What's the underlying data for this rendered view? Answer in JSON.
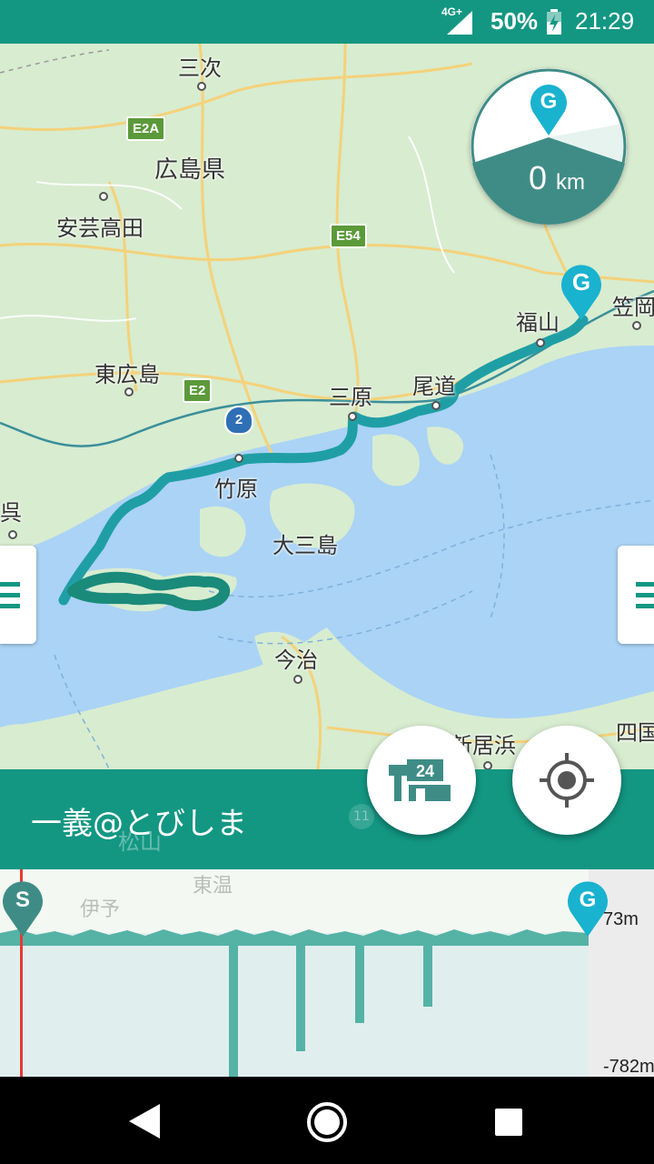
{
  "status_bar": {
    "network": "4G+",
    "battery": "50%",
    "time": "21:29"
  },
  "map": {
    "places": [
      "三次",
      "広島県",
      "安芸高田",
      "東広島",
      "三原",
      "尾道",
      "福山",
      "笠岡",
      "竹原",
      "呉",
      "大三島",
      "今治",
      "新居浜",
      "四国",
      "松山",
      "東温",
      "伊予"
    ],
    "road_shields": [
      "E2A",
      "E54",
      "E2",
      "2",
      "11"
    ]
  },
  "gauge": {
    "marker": "G",
    "distance_value": "0",
    "distance_unit": "km"
  },
  "route": {
    "title": "一義@とびしま"
  },
  "elevation": {
    "start_marker": "S",
    "goal_marker": "G",
    "max_label": "73m",
    "min_label": "-782m",
    "profile_fraction": 0.0
  },
  "colors": {
    "primary": "#139783",
    "route": "#1f9fa5",
    "marker": "#19b2cf",
    "cursor": "#e53935"
  }
}
